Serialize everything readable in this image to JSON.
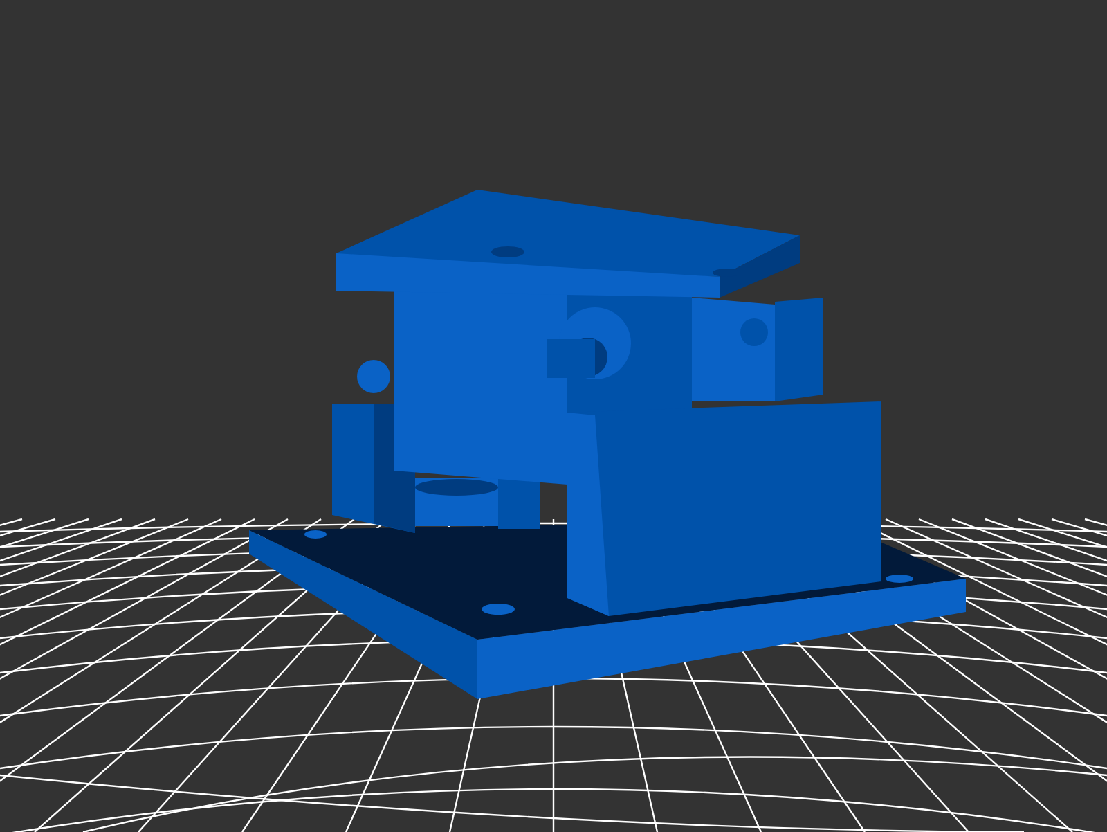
{
  "viewport": {
    "kind": "render3d"
  }
}
